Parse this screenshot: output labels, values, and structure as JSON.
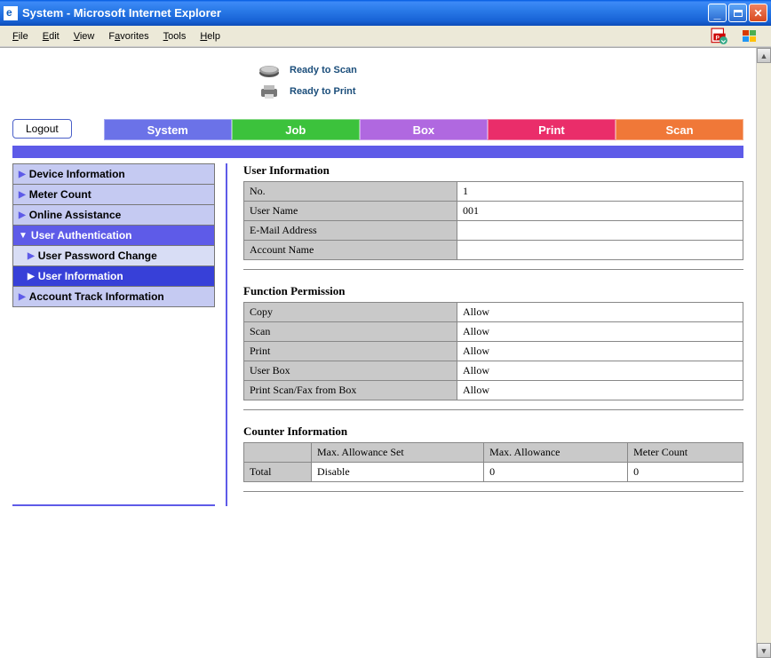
{
  "window": {
    "title": "System - Microsoft Internet Explorer"
  },
  "menubar": {
    "file": "File",
    "edit": "Edit",
    "view": "View",
    "favorites": "Favorites",
    "tools": "Tools",
    "help": "Help"
  },
  "status": {
    "scan": "Ready to Scan",
    "print": "Ready to Print"
  },
  "logout": "Logout",
  "tabs": {
    "system": "System",
    "job": "Job",
    "box": "Box",
    "print": "Print",
    "scan": "Scan"
  },
  "sidebar": {
    "device_info": "Device Information",
    "meter_count": "Meter Count",
    "online_assist": "Online Assistance",
    "user_auth": "User Authentication",
    "user_pw_change": "User Password Change",
    "user_info": "User Information",
    "account_track": "Account Track Information"
  },
  "sections": {
    "user_info": {
      "title": "User Information",
      "rows": {
        "no_label": "No.",
        "no_value": "1",
        "username_label": "User Name",
        "username_value": "001",
        "email_label": "E-Mail Address",
        "email_value": "",
        "account_label": "Account Name",
        "account_value": ""
      }
    },
    "func_perm": {
      "title": "Function Permission",
      "rows": {
        "copy_label": "Copy",
        "copy_value": "Allow",
        "scan_label": "Scan",
        "scan_value": "Allow",
        "print_label": "Print",
        "print_value": "Allow",
        "userbox_label": "User Box",
        "userbox_value": "Allow",
        "pfb_label": "Print Scan/Fax from Box",
        "pfb_value": "Allow"
      }
    },
    "counter": {
      "title": "Counter Information",
      "headers": {
        "blank": "",
        "max_set": "Max. Allowance Set",
        "max_allow": "Max. Allowance",
        "meter": "Meter Count"
      },
      "row": {
        "label": "Total",
        "max_set": "Disable",
        "max_allow": "0",
        "meter": "0"
      }
    }
  }
}
